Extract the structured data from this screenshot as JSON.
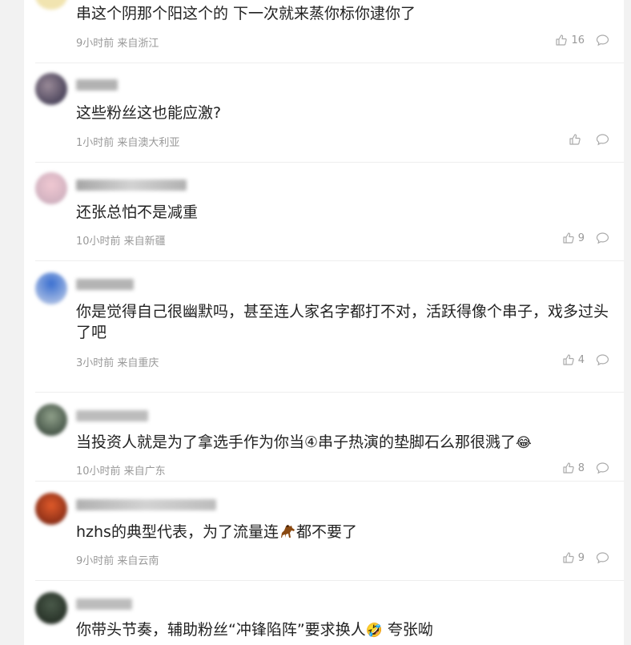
{
  "comments": [
    {
      "text": "串这个阴那个阳这个的 下一次就来蒸你标你逮你了",
      "meta": "9小时前 来自浙江",
      "likes": "16"
    },
    {
      "text": "这些粉丝这也能应激?",
      "meta": "1小时前 来自澳大利亚",
      "likes": ""
    },
    {
      "text": "还张总怕不是减重",
      "meta": "10小时前 来自新疆",
      "likes": "9"
    },
    {
      "text": "你是觉得自己很幽默吗，甚至连人家名字都打不对，活跃得像个串子，戏多过头了吧",
      "meta": "3小时前 来自重庆",
      "likes": "4"
    },
    {
      "text": "当投资人就是为了拿选手作为你当④串子热演的垫脚石么那很溅了",
      "meta": "10小时前 来自广东",
      "likes": "8"
    },
    {
      "text_before": "hzhs的典型代表，为了流量连",
      "text_after": "都不要了",
      "meta": "9小时前 来自云南",
      "likes": "9"
    },
    {
      "text_before": "你带头节奏，辅助粉丝“冲锋陷阵”要求换人",
      "text_after": " 夸张呦",
      "meta": "",
      "likes": ""
    }
  ],
  "icons": {
    "like": "thumbs-up-icon",
    "reply": "comment-bubble-icon"
  },
  "colors": {
    "text": "#222222",
    "meta": "#999999",
    "divider": "#eeeeee"
  }
}
